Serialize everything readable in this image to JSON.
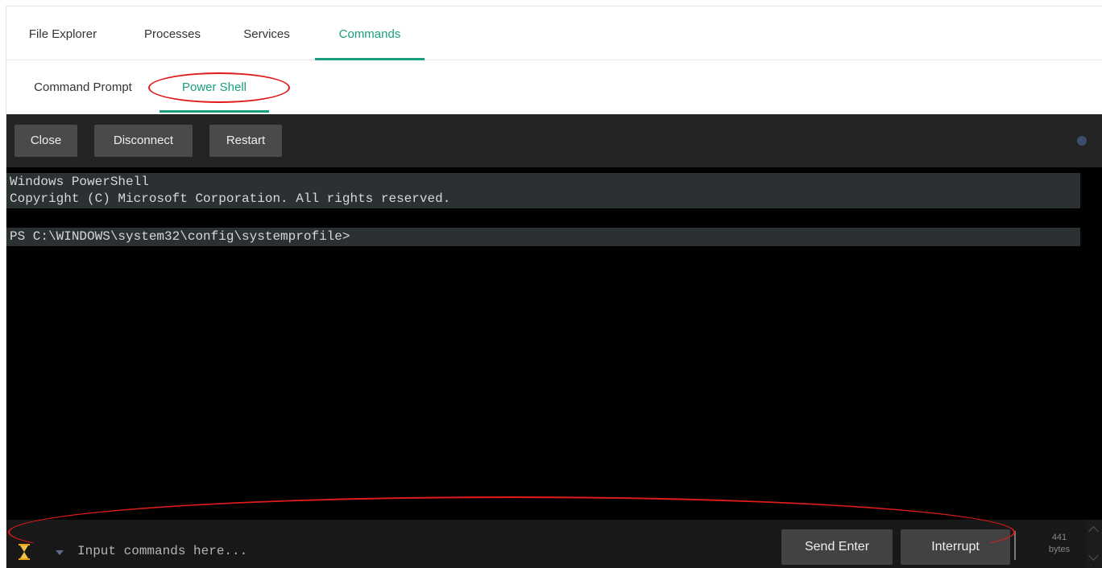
{
  "main_tabs": [
    {
      "label": "File Explorer",
      "active": false
    },
    {
      "label": "Processes",
      "active": false
    },
    {
      "label": "Services",
      "active": false
    },
    {
      "label": "Commands",
      "active": true
    }
  ],
  "sub_tabs": [
    {
      "label": "Command Prompt",
      "active": false
    },
    {
      "label": "Power Shell",
      "active": true
    }
  ],
  "toolbar": {
    "close_label": "Close",
    "disconnect_label": "Disconnect",
    "restart_label": "Restart"
  },
  "terminal": {
    "lines": [
      "Windows PowerShell",
      "Copyright (C) Microsoft Corporation. All rights reserved.",
      "PS C:\\WINDOWS\\system32\\config\\systemprofile>"
    ]
  },
  "input_bar": {
    "placeholder": "Input commands here...",
    "value": "",
    "send_enter_label": "Send Enter",
    "interrupt_label": "Interrupt",
    "byte_count": "441",
    "byte_unit": "bytes"
  },
  "icons": {
    "status": "status-dot",
    "busy": "hourglass-icon",
    "history": "caret-down-icon"
  },
  "colors": {
    "accent": "#1a9e80",
    "annotation": "#e01b1b",
    "terminal_bg": "#000000",
    "line_highlight": "#2b3133"
  }
}
